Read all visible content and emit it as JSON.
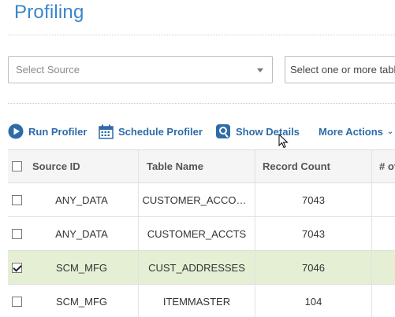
{
  "page": {
    "title": "Profiling"
  },
  "filters": {
    "source_placeholder": "Select Source",
    "tables_placeholder": "Select one or more tabl"
  },
  "toolbar": {
    "run_label": "Run Profiler",
    "schedule_label": "Schedule Profiler",
    "details_label": "Show Details",
    "more_label": "More Actions"
  },
  "colors": {
    "accent": "#3a86c8",
    "action": "#2d6ca8",
    "selected_row": "#e4efd4"
  },
  "grid": {
    "headers": {
      "source_id": "Source ID",
      "table_name": "Table Name",
      "record_count": "Record Count",
      "more": "# of"
    },
    "rows": [
      {
        "checked": false,
        "source_id": "ANY_DATA",
        "table_name": "CUSTOMER_ACCOU...",
        "record_count": "7043"
      },
      {
        "checked": false,
        "source_id": "ANY_DATA",
        "table_name": "CUSTOMER_ACCTS",
        "record_count": "7043"
      },
      {
        "checked": true,
        "source_id": "SCM_MFG",
        "table_name": "CUST_ADDRESSES",
        "record_count": "7046"
      },
      {
        "checked": false,
        "source_id": "SCM_MFG",
        "table_name": "ITEMMASTER",
        "record_count": "104"
      }
    ]
  }
}
